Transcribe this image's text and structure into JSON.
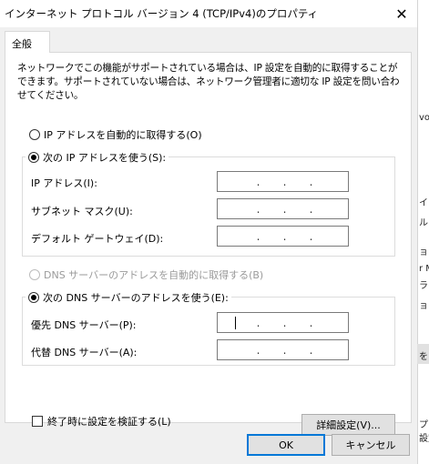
{
  "window": {
    "title": "インターネット プロトコル バージョン 4 (TCP/IPv4)のプロパティ",
    "close_glyph": "✕"
  },
  "tabs": [
    {
      "label": "全般",
      "selected": true
    }
  ],
  "description": "ネットワークでこの機能がサポートされている場合は、IP 設定を自動的に取得することができます。サポートされていない場合は、ネットワーク管理者に適切な IP 設定を問い合わせてください。",
  "ip_mode": {
    "auto_label": "IP アドレスを自動的に取得する(O)",
    "manual_label": "次の IP アドレスを使う(S):",
    "selected": "manual"
  },
  "ip_fields": {
    "address_label": "IP アドレス(I):",
    "subnet_label": "サブネット マスク(U):",
    "gateway_label": "デフォルト ゲートウェイ(D):"
  },
  "dns_mode": {
    "auto_label": "DNS サーバーのアドレスを自動的に取得する(B)",
    "manual_label": "次の DNS サーバーのアドレスを使う(E):",
    "selected": "manual",
    "auto_disabled": true
  },
  "dns_fields": {
    "preferred_label": "優先 DNS サーバー(P):",
    "alternate_label": "代替 DNS サーバー(A):"
  },
  "ip_separator": ".",
  "validate_checkbox": {
    "label": "終了時に設定を検証する(L)",
    "checked": false
  },
  "buttons": {
    "advanced": "詳細設定(V)...",
    "ok": "OK",
    "cancel": "キャンセル"
  },
  "background_fragments": [
    "vo",
    "イア",
    "ル",
    "ョ",
    "r M",
    "ライ",
    "ョ",
    "を",
    "プロ",
    "設定"
  ],
  "colors": {
    "accent": "#0078d7",
    "panel": "#ffffff",
    "window": "#f0f0f0"
  }
}
